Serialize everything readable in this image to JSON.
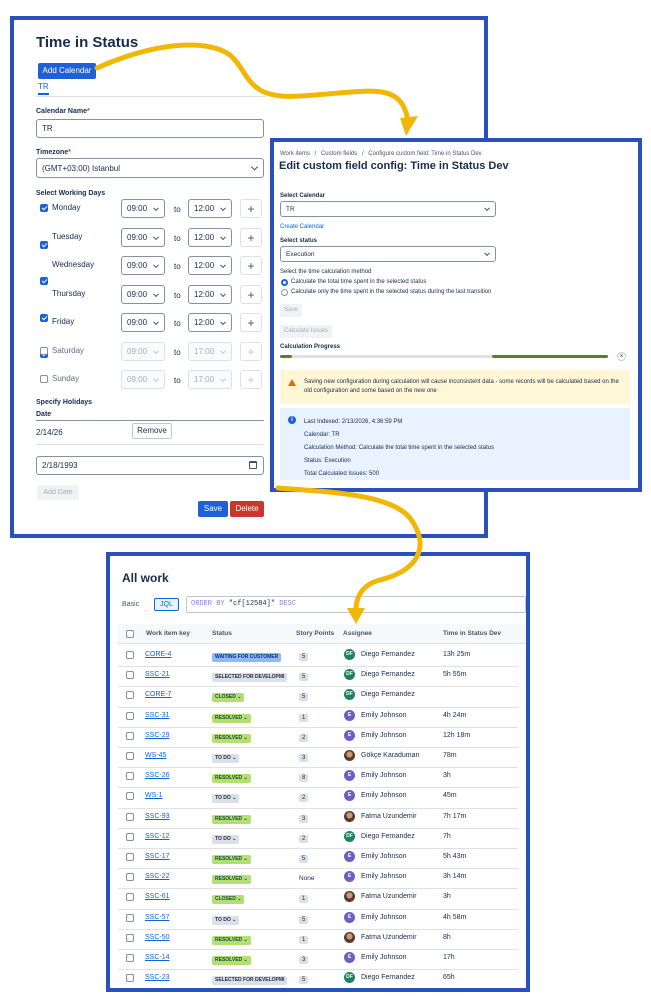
{
  "calendar_panel": {
    "title": "Time in Status",
    "add_calendar_label": "Add Calendar",
    "tab_label": "TR",
    "calendar_name_label": "Calendar Name",
    "calendar_name_value": "TR",
    "timezone_label": "Timezone",
    "timezone_value": "(GMT+03:00) Istanbul",
    "working_days_label": "Select Working Days",
    "to_label": "to",
    "days": [
      {
        "name": "Monday",
        "checked": true,
        "start": "09:00",
        "end": "12:00"
      },
      {
        "name": "Tuesday",
        "checked": true,
        "start": "09:00",
        "end": "12:00"
      },
      {
        "name": "Wednesday",
        "checked": true,
        "start": "09:00",
        "end": "12:00"
      },
      {
        "name": "Thursday",
        "checked": true,
        "start": "09:00",
        "end": "12:00"
      },
      {
        "name": "Friday",
        "checked": true,
        "start": "09:00",
        "end": "12:00"
      },
      {
        "name": "Saturday",
        "checked": false,
        "start": "09:00",
        "end": "17:00"
      },
      {
        "name": "Sunday",
        "checked": false,
        "start": "09:00",
        "end": "17:00"
      }
    ],
    "holidays_label": "Specify Holidays",
    "date_label": "Date",
    "holiday_value": "2/14/26",
    "remove_label": "Remove",
    "date_input_value": "2/18/1993",
    "add_date_label": "Add Date",
    "save_label": "Save",
    "delete_label": "Delete"
  },
  "config_panel": {
    "breadcrumb": [
      "Work items",
      "Custom fields",
      "Configure custom field: Time in Status Dev"
    ],
    "breadcrumb_sep": "/",
    "title": "Edit custom field config: Time in Status Dev",
    "select_calendar_label": "Select Calendar",
    "calendar_value": "TR",
    "create_calendar_link": "Create Calendar",
    "select_status_label": "Select status",
    "status_value": "Execution",
    "method_label": "Select the time calculation method",
    "method_options": [
      {
        "label": "Calculate the total time spent in the selected status",
        "selected": true
      },
      {
        "label": "Calculate only the time spent in the selected status during the last transition",
        "selected": false
      }
    ],
    "save_label": "Save",
    "calculate_label": "Calculate Issues",
    "progress_label": "Calculation Progress",
    "warning_text": "Saving new configuration during calculation will cause inconsistent data - some records will be calculated based on the old configuration and some based on the new one",
    "info_lines": [
      "Last Indexed: 2/13/2026, 4:36:59 PM",
      "Calendar: TR",
      "Calculation Method: Calculate the total time spent in the selected status",
      "Status: Execution",
      "Total Calculated Issues: 500"
    ],
    "colors": {
      "warning_bg": "#fff7d6",
      "info_bg": "#e9f2ff",
      "progress": "#5b7f24"
    }
  },
  "work_panel": {
    "title": "All work",
    "basic_label": "Basic",
    "jql_label": "JQL",
    "query_keyword": "ORDER BY",
    "query_field": "\"cf[12584]\"",
    "query_dir": "DESC",
    "columns": [
      "Work item key",
      "Status",
      "Story Points",
      "Assignee",
      "Time in Status Dev"
    ],
    "rows": [
      {
        "key": "CORE-4",
        "status": "WAITING FOR CUSTOMER",
        "status_kind": "blue",
        "points": "5",
        "initials": "DF",
        "avatar_kind": "df",
        "assignee": "Diego Fernandez",
        "time": "13h 25m"
      },
      {
        "key": "SSC-21",
        "status": "SELECTED FOR DEVELOPMI",
        "status_kind": "grey",
        "points": "5",
        "initials": "DF",
        "avatar_kind": "df",
        "assignee": "Diego Fernandez",
        "time": "5h 55m"
      },
      {
        "key": "CORE-7",
        "status": "CLOSED",
        "status_kind": "green",
        "points": "5",
        "initials": "DF",
        "avatar_kind": "df",
        "assignee": "Diego Fernandez",
        "time": ""
      },
      {
        "key": "SSC-31",
        "status": "RESOLVED",
        "status_kind": "green",
        "points": "1",
        "initials": "E",
        "avatar_kind": "e",
        "assignee": "Emily Johnson",
        "time": "4h 24m"
      },
      {
        "key": "SSC-29",
        "status": "RESOLVED",
        "status_kind": "green",
        "points": "2",
        "initials": "E",
        "avatar_kind": "e",
        "assignee": "Emily Johnson",
        "time": "12h 18m"
      },
      {
        "key": "WS-45",
        "status": "TO DO",
        "status_kind": "grey",
        "points": "3",
        "initials": "",
        "avatar_kind": "photo",
        "assignee": "Gökçe Karaduman",
        "time": "78m"
      },
      {
        "key": "SSC-26",
        "status": "RESOLVED",
        "status_kind": "green",
        "points": "8",
        "initials": "E",
        "avatar_kind": "e",
        "assignee": "Emily Johnson",
        "time": "3h"
      },
      {
        "key": "WS-1",
        "status": "TO DO",
        "status_kind": "grey",
        "points": "2",
        "initials": "E",
        "avatar_kind": "e",
        "assignee": "Emily Johnson",
        "time": "45m"
      },
      {
        "key": "SSC-93",
        "status": "RESOLVED",
        "status_kind": "green",
        "points": "3",
        "initials": "",
        "avatar_kind": "photo",
        "assignee": "Fatma Uzundemir",
        "time": "7h 17m"
      },
      {
        "key": "SSC-12",
        "status": "TO DO",
        "status_kind": "grey",
        "points": "2",
        "initials": "DF",
        "avatar_kind": "df",
        "assignee": "Diego Fernandez",
        "time": "7h"
      },
      {
        "key": "SSC-17",
        "status": "RESOLVED",
        "status_kind": "green",
        "points": "5",
        "initials": "E",
        "avatar_kind": "e",
        "assignee": "Emily Johnson",
        "time": "5h 43m"
      },
      {
        "key": "SSC-22",
        "status": "RESOLVED",
        "status_kind": "green",
        "points": "None",
        "initials": "E",
        "avatar_kind": "e",
        "assignee": "Emily Johnson",
        "time": "3h 14m"
      },
      {
        "key": "SSC-61",
        "status": "CLOSED",
        "status_kind": "green",
        "points": "1",
        "initials": "",
        "avatar_kind": "photo",
        "assignee": "Fatma Uzundemir",
        "time": "3h"
      },
      {
        "key": "SSC-57",
        "status": "TO DO",
        "status_kind": "grey",
        "points": "5",
        "initials": "E",
        "avatar_kind": "e",
        "assignee": "Emily Johnson",
        "time": "4h 58m"
      },
      {
        "key": "SSC-50",
        "status": "RESOLVED",
        "status_kind": "green",
        "points": "1",
        "initials": "",
        "avatar_kind": "photo",
        "assignee": "Fatma Uzundemir",
        "time": "8h"
      },
      {
        "key": "SSC-14",
        "status": "RESOLVED",
        "status_kind": "green",
        "points": "3",
        "initials": "E",
        "avatar_kind": "e",
        "assignee": "Emily Johnson",
        "time": "17h"
      },
      {
        "key": "SSC-23",
        "status": "SELECTED FOR DEVELOPMI",
        "status_kind": "grey",
        "points": "5",
        "initials": "DF",
        "avatar_kind": "df",
        "assignee": "Diego Fernandez",
        "time": "65h"
      }
    ]
  },
  "colors": {
    "frame": "#2a4fbf",
    "arrow": "#f2b705",
    "primary": "#1f60d9",
    "danger": "#c9372c"
  }
}
